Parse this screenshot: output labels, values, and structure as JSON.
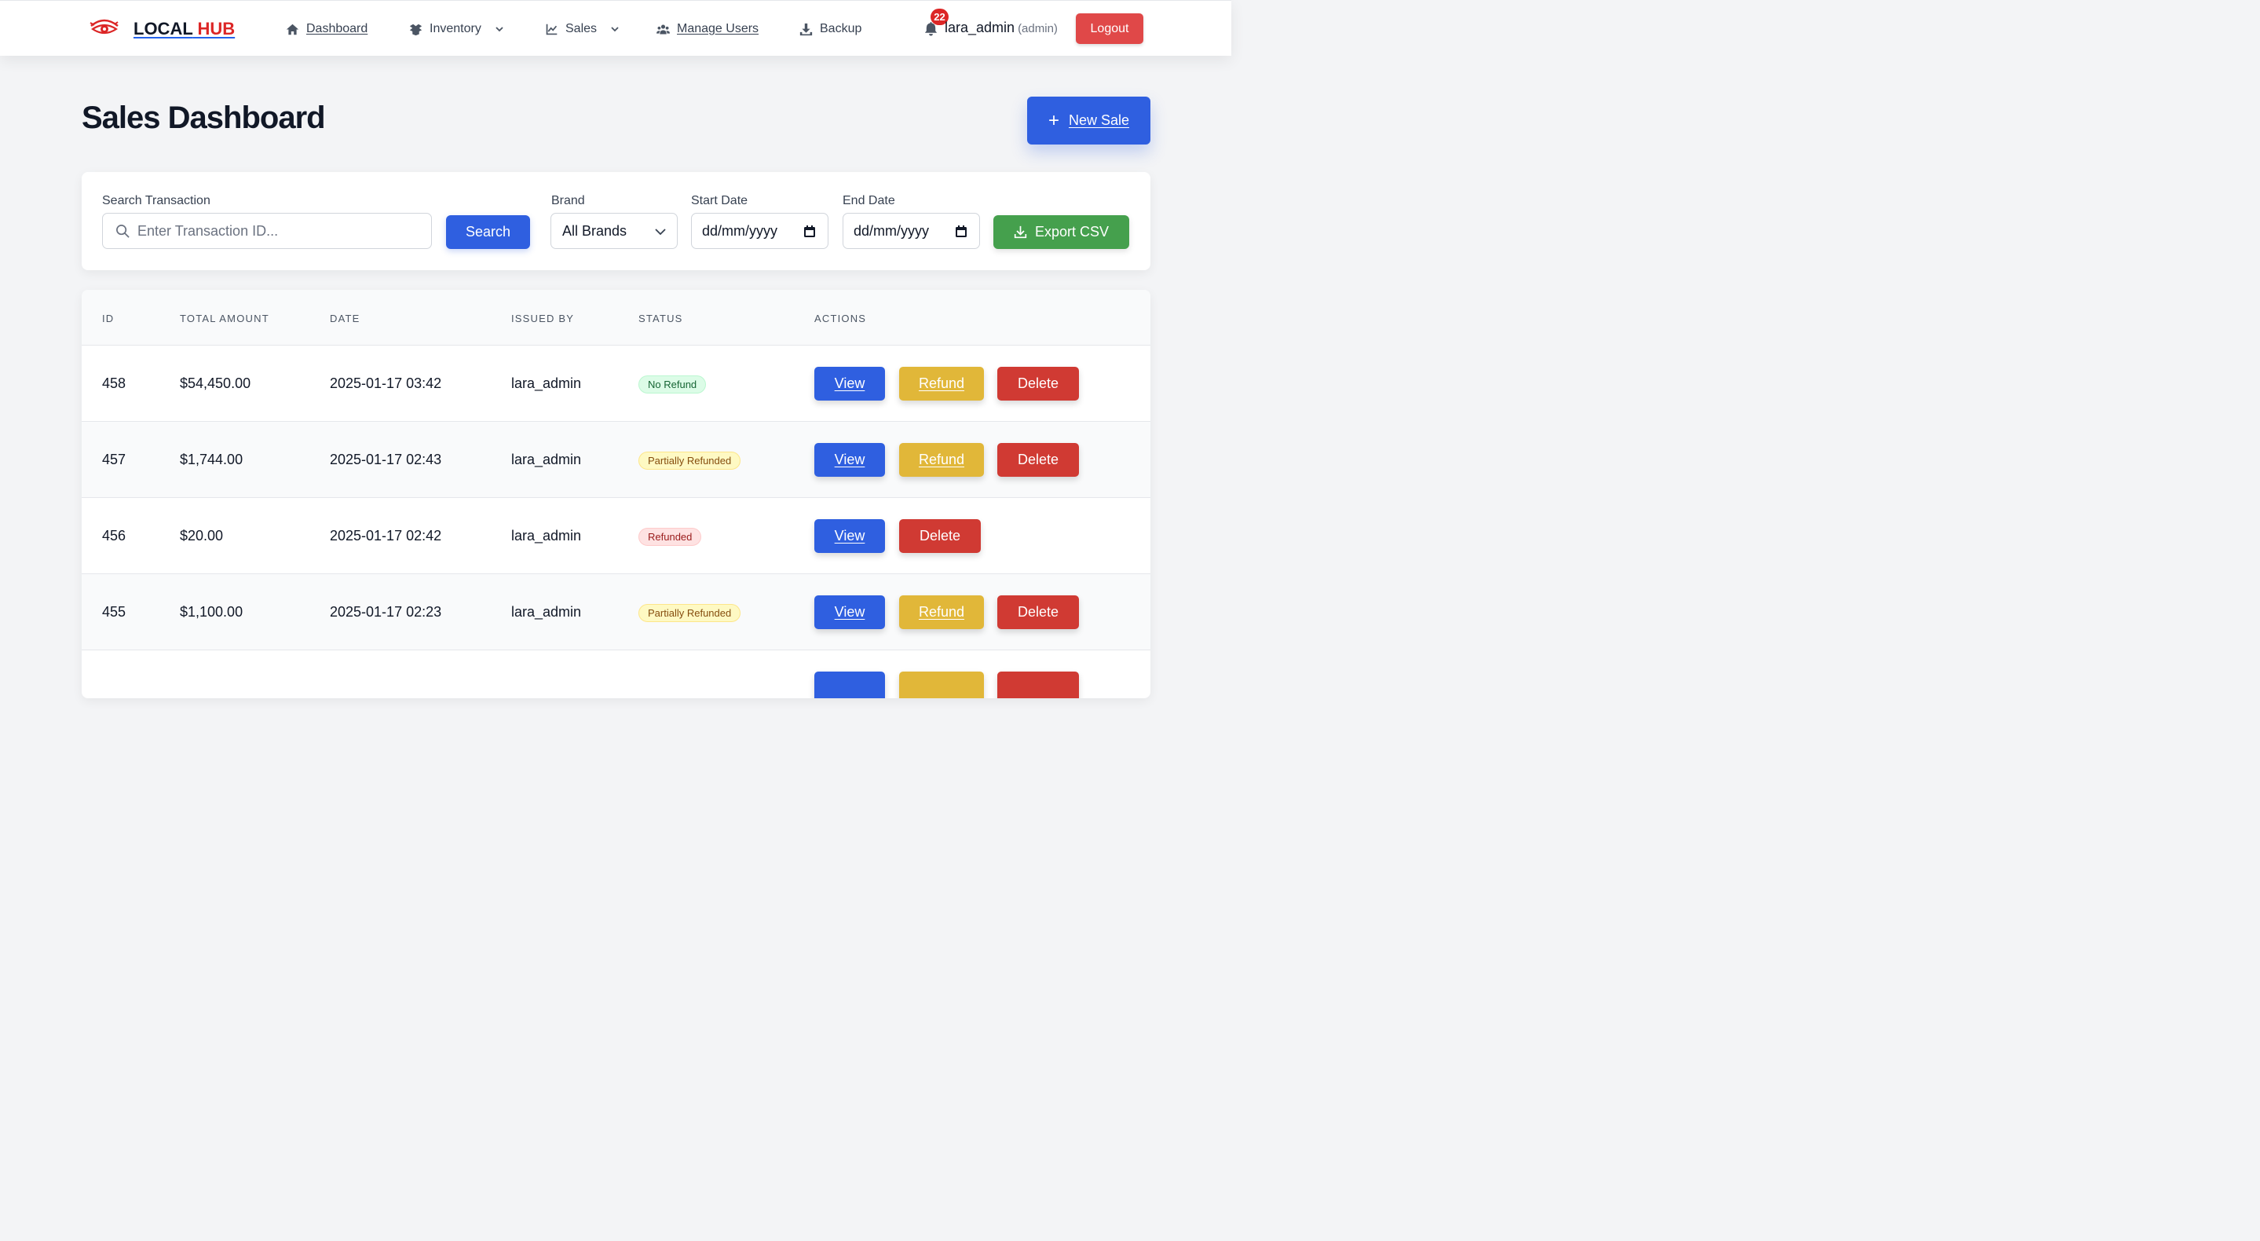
{
  "navbar": {
    "brand_local": "LOCAL",
    "brand_hub": "HUB",
    "items": [
      {
        "label": "Dashboard",
        "icon": "home-icon"
      },
      {
        "label": "Inventory",
        "icon": "box-icon"
      },
      {
        "label": "Sales",
        "icon": "chart-icon"
      },
      {
        "label": "Manage Users",
        "icon": "users-icon"
      },
      {
        "label": "Backup",
        "icon": "download-icon"
      }
    ],
    "notification_count": "22",
    "username": "lara_admin",
    "role": "(admin)",
    "logout_label": "Logout"
  },
  "page": {
    "title": "Sales Dashboard",
    "new_sale_label": "New Sale"
  },
  "filters": {
    "search_label": "Search Transaction",
    "search_placeholder": "Enter Transaction ID...",
    "search_button": "Search",
    "brand_label": "Brand",
    "brand_value": "All Brands",
    "start_date_label": "Start Date",
    "start_date_value": "dd/mm/yyyy",
    "end_date_label": "End Date",
    "end_date_value": "dd/mm/yyyy",
    "export_label": "Export CSV"
  },
  "table": {
    "headers": [
      "ID",
      "TOTAL AMOUNT",
      "DATE",
      "ISSUED BY",
      "STATUS",
      "ACTIONS"
    ],
    "action_labels": {
      "view": "View",
      "refund": "Refund",
      "delete": "Delete"
    },
    "rows": [
      {
        "id": "458",
        "amount": "$54,450.00",
        "date": "2025-01-17 03:42",
        "issued_by": "lara_admin",
        "status": "No Refund"
      },
      {
        "id": "457",
        "amount": "$1,744.00",
        "date": "2025-01-17 02:43",
        "issued_by": "lara_admin",
        "status": "Partially Refunded"
      },
      {
        "id": "456",
        "amount": "$20.00",
        "date": "2025-01-17 02:42",
        "issued_by": "lara_admin",
        "status": "Refunded"
      },
      {
        "id": "455",
        "amount": "$1,100.00",
        "date": "2025-01-17 02:23",
        "issued_by": "lara_admin",
        "status": "Partially Refunded"
      }
    ]
  },
  "colors": {
    "primary": "#2f5fe0",
    "danger": "#d03a33",
    "warning": "#e1b739",
    "success": "#45a04d",
    "brand_red": "#dc2626"
  }
}
